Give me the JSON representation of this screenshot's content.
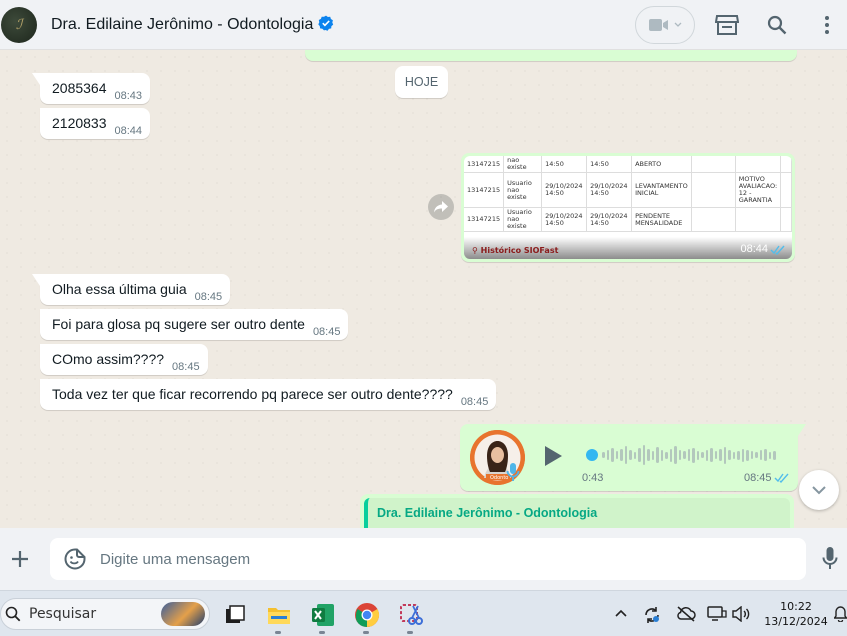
{
  "header": {
    "contact_name": "Dra. Edilaine Jerônimo - Odontologia",
    "icons": [
      "video-call-icon",
      "catalog-store-icon",
      "search-icon",
      "more-options-icon"
    ]
  },
  "chat": {
    "day_label": "HOJE",
    "incoming_messages": [
      {
        "text": "2085364",
        "time": "08:43"
      },
      {
        "text": "2120833",
        "time": "08:44"
      },
      {
        "text": "Olha essa última guia",
        "time": "08:45"
      },
      {
        "text": "Foi para glosa pq sugere ser outro dente",
        "time": "08:45"
      },
      {
        "text": "COmo assim????",
        "time": "08:45"
      },
      {
        "text": "Toda vez ter que ficar recorrendo pq parece ser outro dente????",
        "time": "08:45"
      }
    ],
    "image_message": {
      "time": "08:44",
      "caption": "Histórico SIOFast",
      "rows": [
        {
          "id": "13147215",
          "user": "nao existe",
          "d1": "14:50",
          "d2": "14:50",
          "status": "ABERTO",
          "note": ""
        },
        {
          "id": "13147215",
          "user": "Usuario nao existe",
          "d1": "29/10/2024 14:50",
          "d2": "29/10/2024 14:50",
          "status": "LEVANTAMENTO INICIAL",
          "note": "MOTIVO AVALIACAO: 12 - GARANTIA"
        },
        {
          "id": "13147215",
          "user": "Usuario nao existe",
          "d1": "29/10/2024 14:50",
          "d2": "29/10/2024 14:50",
          "status": "PENDENTE MENSALIDADE",
          "note": ""
        }
      ]
    },
    "audio_message": {
      "duration": "0:43",
      "time": "08:45",
      "avatar_label": "Odonto"
    },
    "reply_quote": {
      "author": "Dra. Edilaine Jerônimo - Odontologia"
    }
  },
  "composer": {
    "placeholder": "Digite uma mensagem"
  },
  "taskbar": {
    "search_label": "Pesquisar",
    "time": "10:22",
    "date": "13/12/2024",
    "apps": [
      "task-view-icon",
      "file-explorer-icon",
      "excel-icon",
      "chrome-icon",
      "snipping-tool-icon"
    ]
  },
  "colors": {
    "outgoing_bubble": "#d9fdd3",
    "incoming_bubble": "#ffffff",
    "chat_bg": "#efeae2",
    "accent_green": "#06cf9c",
    "read_tick": "#53bdeb"
  }
}
